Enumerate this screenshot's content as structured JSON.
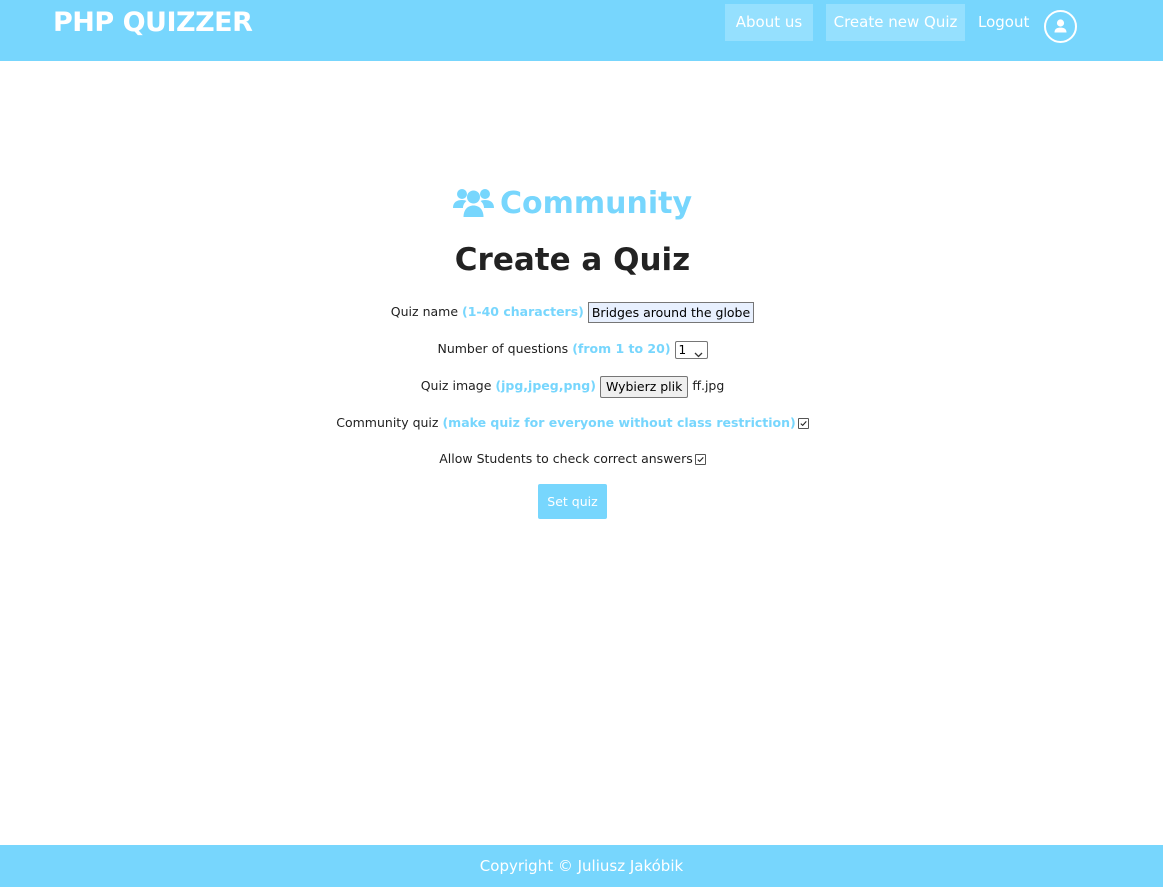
{
  "header": {
    "brand": "PHP QUIZZER",
    "nav": {
      "about": "About us",
      "create": "Create new Quiz",
      "logout": "Logout"
    }
  },
  "main": {
    "section": "Community",
    "title": "Create a Quiz",
    "form": {
      "quiz_name": {
        "label": "Quiz name",
        "hint": "(1-40 characters)",
        "value": "Bridges around the globe"
      },
      "question_count": {
        "label": "Number of questions",
        "hint": "(from 1 to 20)",
        "selected": "1"
      },
      "quiz_image": {
        "label": "Quiz image",
        "hint": "(jpg,jpeg,png)",
        "button": "Wybierz plik",
        "file_name": "ff.jpg"
      },
      "community_quiz": {
        "label": "Community quiz",
        "hint": "(make quiz for everyone without class restriction)",
        "checked": true
      },
      "allow_check": {
        "label": "Allow Students to check correct answers",
        "checked": true
      },
      "submit": "Set quiz"
    }
  },
  "footer": {
    "copyright": "Copyright © Juliusz Jakóbik"
  },
  "colors": {
    "accent": "#77d6fd",
    "text": "#1f1f1f"
  },
  "icons": {
    "section": "users-icon",
    "account": "user-circle-icon"
  }
}
